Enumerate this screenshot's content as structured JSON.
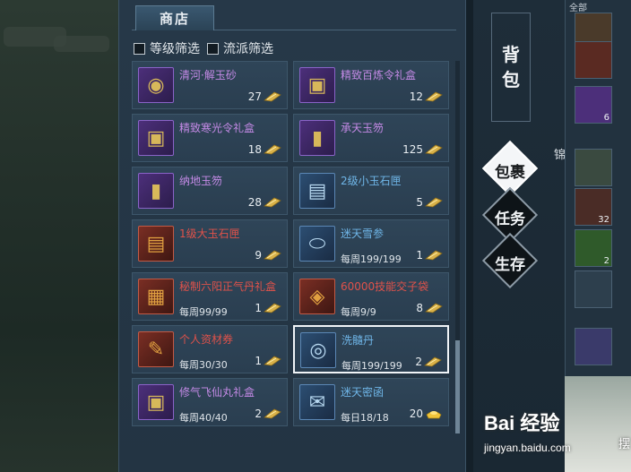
{
  "shop": {
    "tab_label": "商店",
    "filters": [
      {
        "label": "等级筛选",
        "checked": false
      },
      {
        "label": "流派筛选",
        "checked": false
      }
    ],
    "items": [
      {
        "name": "清河·解玉砂",
        "limit": "",
        "price": "27",
        "currency": "gold-feather",
        "quality": "purple",
        "icon": "jade-sand-icon"
      },
      {
        "name": "精致百炼令礼盒",
        "limit": "",
        "price": "12",
        "currency": "gold-feather",
        "quality": "purple",
        "icon": "gift-box-icon"
      },
      {
        "name": "精致寒光令礼盒",
        "limit": "",
        "price": "18",
        "currency": "gold-feather",
        "quality": "purple",
        "icon": "gift-box-icon"
      },
      {
        "name": "承天玉笏",
        "limit": "",
        "price": "125",
        "currency": "gold-feather",
        "quality": "purple",
        "icon": "jade-tablet-icon"
      },
      {
        "name": "纳地玉笏",
        "limit": "",
        "price": "28",
        "currency": "gold-feather",
        "quality": "purple",
        "icon": "jade-tablet-icon"
      },
      {
        "name": "2级小玉石匣",
        "limit": "",
        "price": "5",
        "currency": "gold-feather",
        "quality": "blue",
        "icon": "jade-chest-icon"
      },
      {
        "name": "1级大玉石匣",
        "limit": "",
        "price": "9",
        "currency": "gold-feather",
        "quality": "red",
        "icon": "jade-chest-icon"
      },
      {
        "name": "迷天雪参",
        "limit": "每周199/199",
        "price": "1",
        "currency": "gold-feather",
        "quality": "blue",
        "icon": "ginseng-jar-icon"
      },
      {
        "name": "秘制六阳正气丹礼盒",
        "limit": "每周99/99",
        "price": "1",
        "currency": "gold-feather",
        "quality": "red",
        "icon": "pill-box-icon"
      },
      {
        "name": "60000技能交子袋",
        "limit": "每周9/9",
        "price": "8",
        "currency": "gold-feather",
        "quality": "red",
        "icon": "money-bag-icon"
      },
      {
        "name": "个人资材券",
        "limit": "每周30/30",
        "price": "1",
        "currency": "gold-feather",
        "quality": "red",
        "icon": "scroll-ticket-icon"
      },
      {
        "name": "洗髓丹",
        "limit": "每周199/199",
        "price": "2",
        "currency": "gold-feather",
        "quality": "blue",
        "icon": "pill-orb-icon",
        "selected": true
      },
      {
        "name": "修气飞仙丸礼盒",
        "limit": "每周40/40",
        "price": "2",
        "currency": "gold-feather",
        "quality": "purple",
        "icon": "gift-box-icon"
      },
      {
        "name": "迷天密函",
        "limit": "每日18/18",
        "price": "20",
        "currency": "gold-ingot",
        "quality": "blue",
        "icon": "secret-letter-icon"
      }
    ],
    "scroll_position": 0.75
  },
  "bag": {
    "title_chars": [
      "背",
      "包"
    ],
    "tabs": [
      {
        "label": "包裹",
        "active": true
      },
      {
        "label": "任务",
        "active": false
      },
      {
        "label": "生存",
        "active": false
      }
    ]
  },
  "inventory": {
    "header": "全部",
    "side_label": "锦",
    "slot_counts": [
      "",
      "6",
      "",
      "32",
      "2"
    ]
  },
  "watermark": {
    "logo": "Bai 经验",
    "site": "jingyan.baidu.com",
    "tail": "摆"
  },
  "colors": {
    "quality_purple": "#c48ae6",
    "quality_red": "#e0524a",
    "quality_blue": "#6fb6e8",
    "panel_bg": "#263848"
  }
}
